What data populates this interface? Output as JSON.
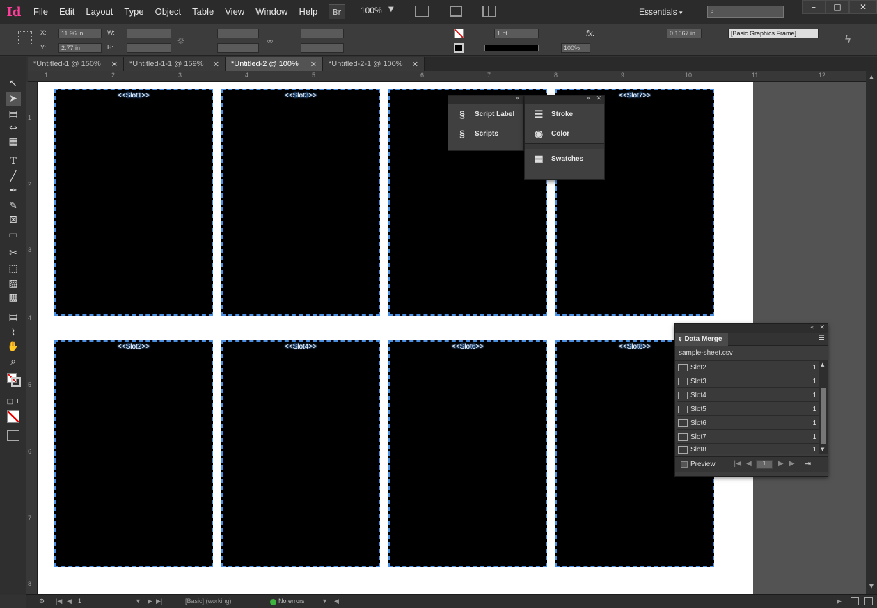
{
  "app": {
    "logo_text": "Id",
    "accent": "#ff3d9a"
  },
  "menu": [
    "File",
    "Edit",
    "Layout",
    "Type",
    "Object",
    "Table",
    "View",
    "Window",
    "Help"
  ],
  "menubar_right": {
    "bridge": "Br",
    "zoom": "100%",
    "workspace": "Essentials"
  },
  "control": {
    "x": "11.96 in",
    "y": "2.77 in",
    "w_label": "W:",
    "h_label": "H:",
    "x_label": "X:",
    "y_label": "Y:",
    "stroke_weight": "1 pt",
    "opacity": "100%",
    "fx": "fx.",
    "frame_offset": "0.1667 in",
    "object_style": "[Basic Graphics Frame]"
  },
  "tabs": [
    {
      "label": "*Untitled-1 @ 150%",
      "active": false
    },
    {
      "label": "*Untitled-1-1 @ 159%",
      "active": false
    },
    {
      "label": "*Untitled-2 @ 100%",
      "active": true
    },
    {
      "label": "*Untitled-2-1 @ 100%",
      "active": false
    }
  ],
  "hruler_numbers": [
    "1",
    "2",
    "3",
    "4",
    "5",
    "6",
    "7",
    "8",
    "9",
    "10",
    "11",
    "12"
  ],
  "vruler_numbers": [
    "1",
    "2",
    "3",
    "4",
    "5",
    "6",
    "7",
    "8"
  ],
  "slots": [
    {
      "label": "<<Slot1>>"
    },
    {
      "label": "<<Slot3>>"
    },
    {
      "label": ""
    },
    {
      "label": "<<Slot7>>"
    },
    {
      "label": "<<Slot2>>"
    },
    {
      "label": "<<Slot4>>"
    },
    {
      "label": "<<Slot6>>"
    },
    {
      "label": "<<Slot8>>"
    }
  ],
  "panels": {
    "left_group": [
      "Script Label",
      "Scripts"
    ],
    "right_group": [
      "Stroke",
      "Color"
    ],
    "right_group2": [
      "Swatches"
    ]
  },
  "data_merge": {
    "title": "Data Merge",
    "source": "sample-sheet.csv",
    "fields": [
      {
        "name": "Slot2",
        "count": "1"
      },
      {
        "name": "Slot3",
        "count": "1"
      },
      {
        "name": "Slot4",
        "count": "1"
      },
      {
        "name": "Slot5",
        "count": "1"
      },
      {
        "name": "Slot6",
        "count": "1"
      },
      {
        "name": "Slot7",
        "count": "1"
      },
      {
        "name": "Slot8",
        "count": "1"
      }
    ],
    "preview_label": "Preview",
    "record": "1"
  },
  "status": {
    "page": "1",
    "preflight_profile": "[Basic] (working)",
    "errors": "No errors"
  }
}
